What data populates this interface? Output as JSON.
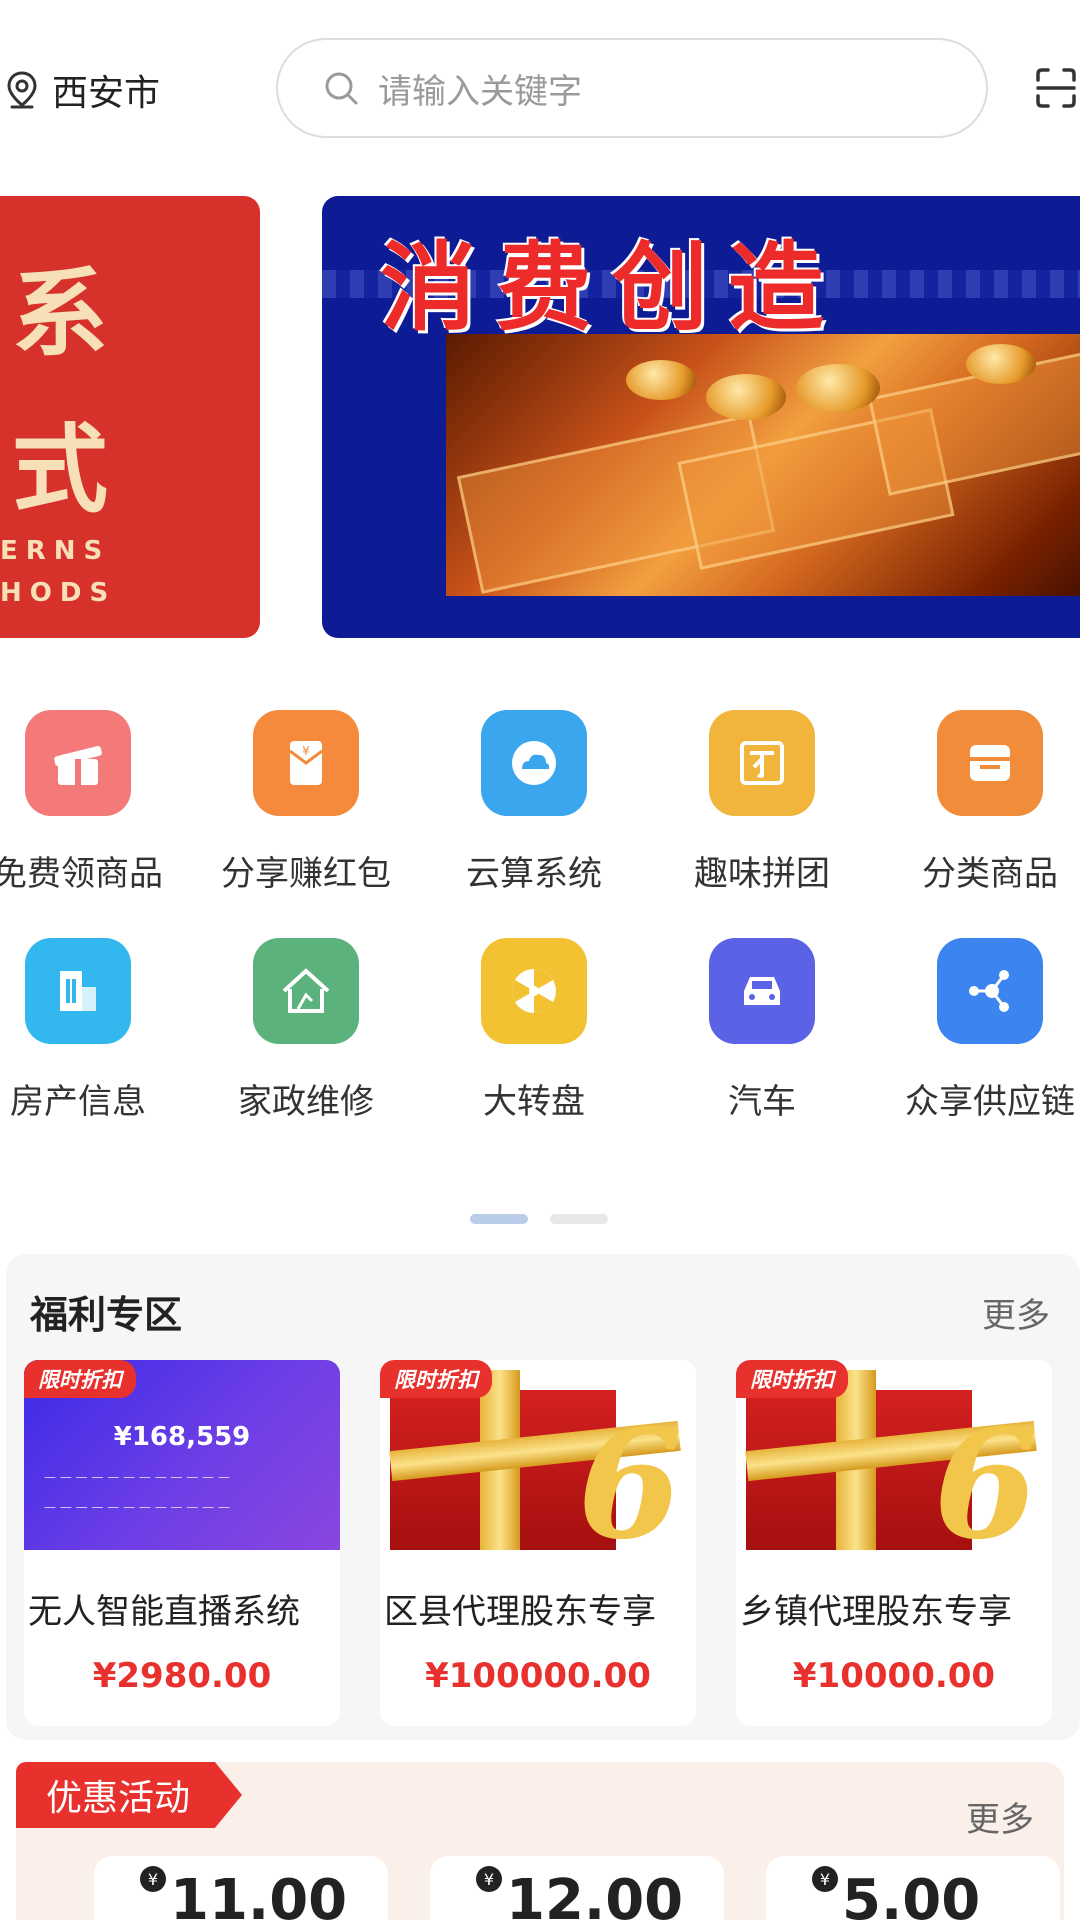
{
  "header": {
    "location": "西安市",
    "search_placeholder": "请输入关键字"
  },
  "banners": {
    "left": {
      "line1": "系",
      "line2": "式",
      "en1": "ERNS",
      "en2": "HODS"
    },
    "right": {
      "title": "消费创造"
    }
  },
  "grid": {
    "items": [
      {
        "label": "免费领商品",
        "icon": "gift-icon",
        "color": "#f47a7a"
      },
      {
        "label": "分享赚红包",
        "icon": "red-envelope-icon",
        "color": "#f58a3c"
      },
      {
        "label": "云算系统",
        "icon": "cloud-icon",
        "color": "#3aa6ee"
      },
      {
        "label": "趣味拼团",
        "icon": "group-buy-icon",
        "color": "#f1b53c"
      },
      {
        "label": "分类商品",
        "icon": "store-icon",
        "color": "#f08c3a"
      },
      {
        "label": "房产信息",
        "icon": "building-icon",
        "color": "#32b8ee"
      },
      {
        "label": "家政维修",
        "icon": "house-clean-icon",
        "color": "#5cb27c"
      },
      {
        "label": "大转盘",
        "icon": "wheel-icon",
        "color": "#f3c233"
      },
      {
        "label": "汽车",
        "icon": "car-icon",
        "color": "#5b62e6"
      },
      {
        "label": "众享供应链",
        "icon": "share-network-icon",
        "color": "#3c84f0"
      }
    ]
  },
  "welfare": {
    "title": "福利专区",
    "more": "更多",
    "tag": "限时折扣",
    "cards": [
      {
        "name": "无人智能直播系统",
        "price": "¥2980.00",
        "image_text": "¥168,559"
      },
      {
        "name": "区县代理股东专享",
        "price": "¥100000.00"
      },
      {
        "name": "乡镇代理股东专享",
        "price": "¥10000.00"
      }
    ]
  },
  "promo": {
    "title": "优惠活动",
    "more": "更多",
    "coupons": [
      {
        "amount": "11.00"
      },
      {
        "amount": "12.00"
      },
      {
        "amount": "5.00"
      }
    ]
  }
}
